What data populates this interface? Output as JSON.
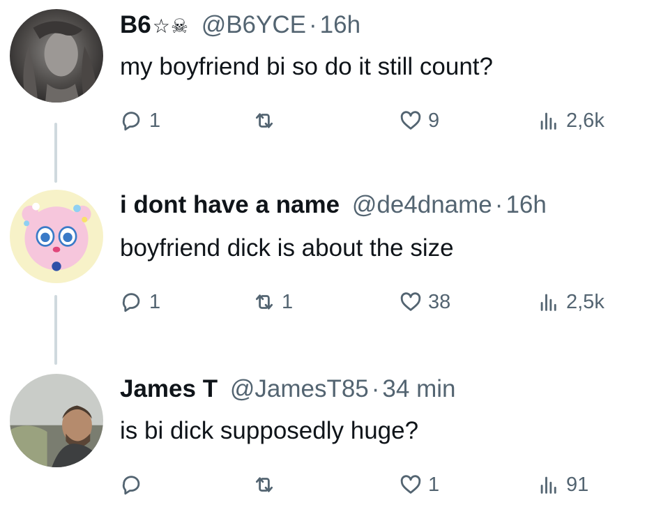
{
  "tweets": [
    {
      "name": "B6",
      "name_icons": "☆☠",
      "handle": "@B6YCE",
      "separator": "·",
      "time": "16h",
      "text": "my boyfriend bi so do it still count?",
      "replies": "1",
      "retweets": "",
      "likes": "9",
      "views": "2,6k"
    },
    {
      "name": "i dont have a name",
      "handle": "@de4dname",
      "separator": "·",
      "time": "16h",
      "text": "boyfriend dick is about the size",
      "replies": "1",
      "retweets": "1",
      "likes": "38",
      "views": "2,5k"
    },
    {
      "name": "James T",
      "handle": "@JamesT85",
      "separator": "·",
      "time": "34 min",
      "text": "is bi dick supposedly huge?",
      "replies": "",
      "retweets": "",
      "likes": "1",
      "views": "91"
    }
  ],
  "icons": {
    "reply": "reply-icon",
    "retweet": "retweet-icon",
    "like": "heart-icon",
    "views": "views-icon"
  },
  "colors": {
    "text": "#0f1419",
    "secondary": "#536471",
    "thread_line": "#cfd9de"
  }
}
